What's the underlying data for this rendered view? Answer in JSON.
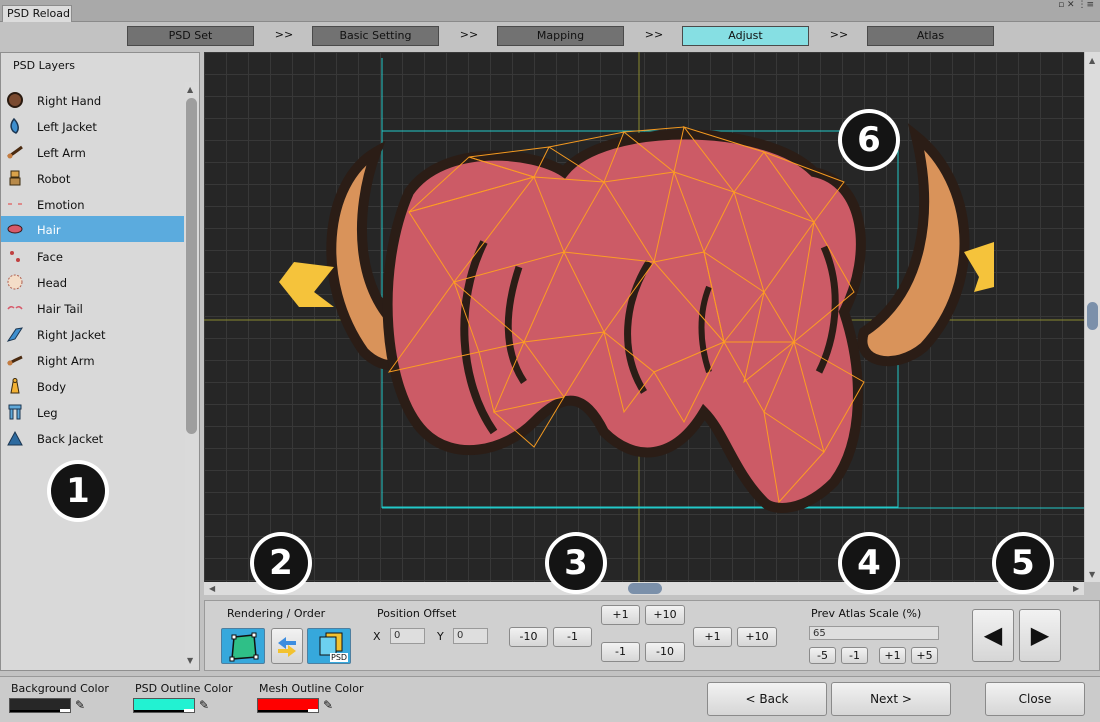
{
  "window": {
    "tab_title": "PSD Reload",
    "controls": "▫ ✕ ⋮≡"
  },
  "steps": [
    {
      "label": "PSD Set",
      "active": false
    },
    {
      "label": "Basic Setting",
      "active": false
    },
    {
      "label": "Mapping",
      "active": false
    },
    {
      "label": "Adjust",
      "active": true
    },
    {
      "label": "Atlas",
      "active": false
    }
  ],
  "step_separator": ">>",
  "layers_panel": {
    "title": "PSD Layers",
    "items": [
      {
        "label": "Right Hand",
        "icon": "right-hand-icon",
        "selected": false
      },
      {
        "label": "Left Jacket",
        "icon": "left-jacket-icon",
        "selected": false
      },
      {
        "label": "Left Arm",
        "icon": "left-arm-icon",
        "selected": false
      },
      {
        "label": "Robot",
        "icon": "robot-icon",
        "selected": false
      },
      {
        "label": "Emotion",
        "icon": "emotion-icon",
        "selected": false
      },
      {
        "label": "Hair",
        "icon": "hair-icon",
        "selected": true
      },
      {
        "label": "Face",
        "icon": "face-icon",
        "selected": false
      },
      {
        "label": "Head",
        "icon": "head-icon",
        "selected": false
      },
      {
        "label": "Hair Tail",
        "icon": "hair-tail-icon",
        "selected": false
      },
      {
        "label": "Right Jacket",
        "icon": "right-jacket-icon",
        "selected": false
      },
      {
        "label": "Right Arm",
        "icon": "right-arm-icon",
        "selected": false
      },
      {
        "label": "Body",
        "icon": "body-icon",
        "selected": false
      },
      {
        "label": "Leg",
        "icon": "leg-icon",
        "selected": false
      },
      {
        "label": "Back Jacket",
        "icon": "back-jacket-icon",
        "selected": false
      }
    ]
  },
  "badges": [
    "1",
    "2",
    "3",
    "4",
    "5",
    "6"
  ],
  "controls": {
    "rendering_label": "Rendering / Order",
    "psd_tool_label": "PSD",
    "position_offset_label": "Position Offset",
    "x_label": "X",
    "x_value": "0",
    "y_label": "Y",
    "y_value": "0",
    "offset_buttons": {
      "up_small": "+1",
      "up_large": "+10",
      "left_large": "-10",
      "left_small": "-1",
      "down_small": "-1",
      "down_large": "-10",
      "right_small": "+1",
      "right_large": "+10"
    },
    "atlas_scale_label": "Prev Atlas Scale (%)",
    "atlas_scale_value": "65",
    "scale_buttons": [
      "-5",
      "-1",
      "+1",
      "+5"
    ],
    "prev_arrow": "◀",
    "next_arrow": "▶"
  },
  "bottom": {
    "background_color_label": "Background Color",
    "psd_outline_color_label": "PSD Outline Color",
    "mesh_outline_color_label": "Mesh Outline Color",
    "back_button": "< Back",
    "next_button": "Next >",
    "close_button": "Close"
  },
  "colors": {
    "background": "#272727",
    "psd_outline": "#22f2d2",
    "mesh_outline": "#ff0000",
    "active_step": "#86dfe3",
    "selected_layer": "#5babde"
  }
}
